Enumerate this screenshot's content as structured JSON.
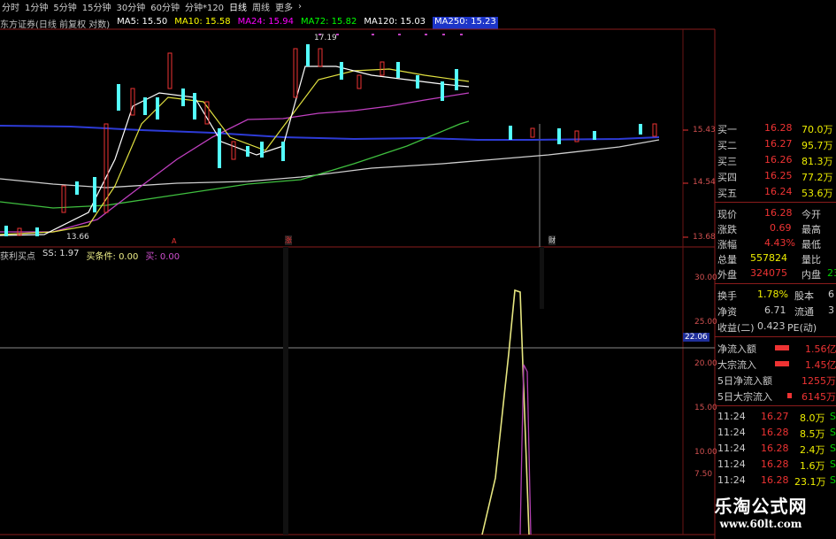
{
  "toolbar": {
    "tabs": [
      "分时",
      "1分钟",
      "5分钟",
      "15分钟",
      "30分钟",
      "60分钟",
      "分钟*120",
      "日线",
      "周线",
      "更多",
      "›"
    ]
  },
  "ma_legend": {
    "title": "东方证券(日线 前复权 对数)",
    "ma5": "MA5: 15.50",
    "ma10": "MA10: 15.58",
    "ma24": "MA24: 15.94",
    "ma72": "MA72: 15.82",
    "ma120": "MA120: 15.03",
    "ma250": "MA250: 15.23",
    "colors": {
      "ma5": "#ffffff",
      "ma10": "#ffff00",
      "ma24": "#ff00ff",
      "ma72": "#00ff00",
      "ma120": "#ffffff",
      "ma250": "#3050ff"
    }
  },
  "price_axis": [
    "15.43",
    "14.54",
    "13.68"
  ],
  "high_label": "17.19",
  "low_label": "13.66",
  "event_markers": [
    "A",
    "涨",
    "财"
  ],
  "indicator_legend": {
    "name": "获利买点",
    "ss": "SS: 1.97",
    "buy": "买条件: 0.00",
    "buy2": "买: 0.00"
  },
  "indicator_axis": [
    "30.00",
    "25.00",
    "22.06",
    "20.00",
    "15.00",
    "10.00",
    "7.50"
  ],
  "order_book": [
    {
      "label": "买一",
      "price": "16.28",
      "vol": "70.0万"
    },
    {
      "label": "买二",
      "price": "16.27",
      "vol": "95.7万"
    },
    {
      "label": "买三",
      "price": "16.26",
      "vol": "81.3万"
    },
    {
      "label": "买四",
      "price": "16.25",
      "vol": "77.2万"
    },
    {
      "label": "买五",
      "price": "16.24",
      "vol": "53.6万"
    }
  ],
  "quote": [
    {
      "l1": "现价",
      "v1": "16.28",
      "l2": "今开"
    },
    {
      "l1": "涨跌",
      "v1": "0.69",
      "l2": "最高"
    },
    {
      "l1": "涨幅",
      "v1": "4.43%",
      "l2": "最低"
    },
    {
      "l1": "总量",
      "v1": "557824",
      "l2": "量比"
    },
    {
      "l1": "外盘",
      "v1": "324075",
      "l2": "内盘",
      "v2": "23"
    }
  ],
  "quote2": [
    {
      "l1": "换手",
      "v1": "1.78%",
      "l2": "股本",
      "v2": "6"
    },
    {
      "l1": "净资",
      "v1": "6.71",
      "l2": "流通",
      "v2": "3"
    },
    {
      "l1": "收益(二)",
      "v1": "0.423",
      "l2": "PE(动)",
      "v2": ""
    }
  ],
  "flows": [
    {
      "label": "净流入额",
      "value": "1.56亿"
    },
    {
      "label": "大宗流入",
      "value": "1.45亿"
    },
    {
      "label": "5日净流入额",
      "value": "1255万"
    },
    {
      "label": "5日大宗流入",
      "value": "6145万"
    }
  ],
  "trades": [
    {
      "time": "11:24",
      "price": "16.27",
      "vol": "8.0万",
      "side": "S"
    },
    {
      "time": "11:24",
      "price": "16.28",
      "vol": "8.5万",
      "side": "S"
    },
    {
      "time": "11:24",
      "price": "16.28",
      "vol": "2.4万",
      "side": "S"
    },
    {
      "time": "11:24",
      "price": "16.28",
      "vol": "1.6万",
      "side": "S"
    },
    {
      "time": "11:24",
      "price": "16.28",
      "vol": "23.1万",
      "side": "S"
    }
  ],
  "watermark": {
    "line1": "乐淘公式网",
    "line2": "www.60lt.com"
  }
}
